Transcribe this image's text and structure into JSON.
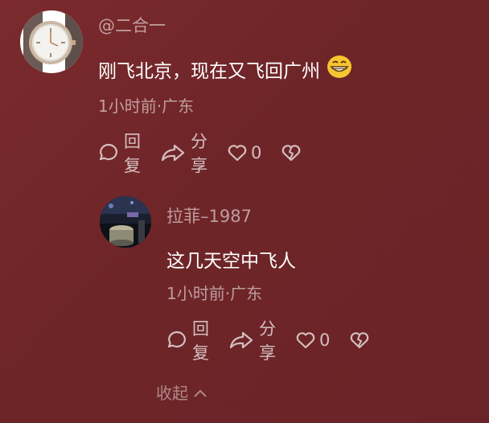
{
  "comment": {
    "username": "@二合一",
    "text": "刚飞北京，现在又飞回广州",
    "emoji": "grinning-face-emoji",
    "meta": "1小时前·广东",
    "actions": {
      "reply_label": "回复",
      "share_label": "分享",
      "like_count": "0"
    }
  },
  "reply": {
    "username": "拉菲–1987",
    "text": "这几天空中飞人",
    "meta": "1小时前·广东",
    "actions": {
      "reply_label": "回复",
      "share_label": "分享",
      "like_count": "0"
    }
  },
  "collapse_label": "收起",
  "icons": {
    "reply": "comment-bubble-icon",
    "share": "share-arrow-icon",
    "like": "heart-icon",
    "dislike": "broken-heart-icon",
    "collapse": "chevron-up-icon"
  }
}
